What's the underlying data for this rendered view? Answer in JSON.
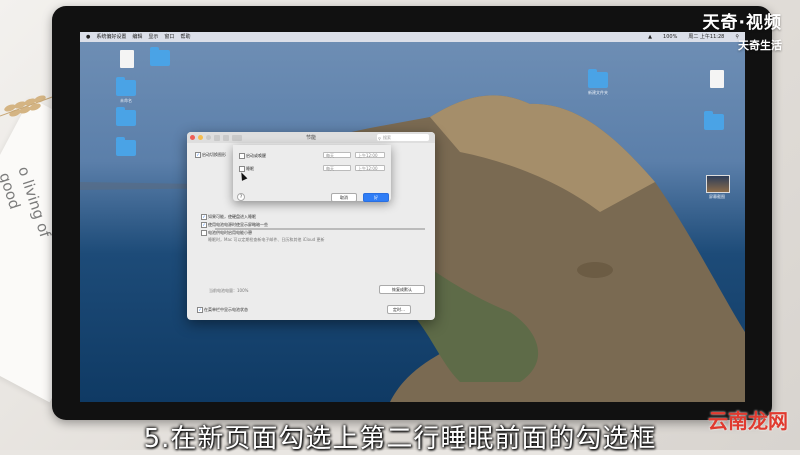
{
  "watermark_top": {
    "line1": "天奇·视频",
    "line2": "天奇生活"
  },
  "watermark_bottom": "云南龙网",
  "caption": "5.在新页面勾选上第二行睡眠前面的勾选框",
  "menubar": {
    "app_name": "系统偏好设置",
    "items": [
      "编辑",
      "显示",
      "窗口",
      "帮助"
    ],
    "right_items": [
      "100%",
      "周二 上午11:28"
    ]
  },
  "desktop_icons": [
    {
      "label": "未命名"
    },
    {
      "label": "屏幕截图"
    },
    {
      "label": "新建文件夹"
    }
  ],
  "pref_window": {
    "title": "节能",
    "search_placeholder": "搜索",
    "options": [
      {
        "label": "启动切换图形",
        "checked": true
      },
      {
        "label": "如果可能，使硬盘进入睡眠",
        "checked": true
      },
      {
        "label": "使用电池电源时使显示屏略暗一些",
        "checked": true
      },
      {
        "label": "电池供电时启用电能小憩",
        "checked": false
      }
    ],
    "option_note": "睡眠时，Mac 可以定期检查新电子邮件、日历和其他 iCloud 更新",
    "battery_label": "当前电池电量：100%",
    "restore_button": "恢复成默认",
    "menubar_status_label": "在菜单栏中显示电池状态",
    "schedule_button": "定时…"
  },
  "schedule_sheet": {
    "rows": [
      {
        "label": "启动或唤醒",
        "day": "每天",
        "time": "上午12:00",
        "checked": false
      },
      {
        "label": "睡眠",
        "day": "每天",
        "time": "上午12:00",
        "checked": false
      }
    ],
    "cancel_button": "取消",
    "ok_button": "好",
    "help_label": "?"
  }
}
